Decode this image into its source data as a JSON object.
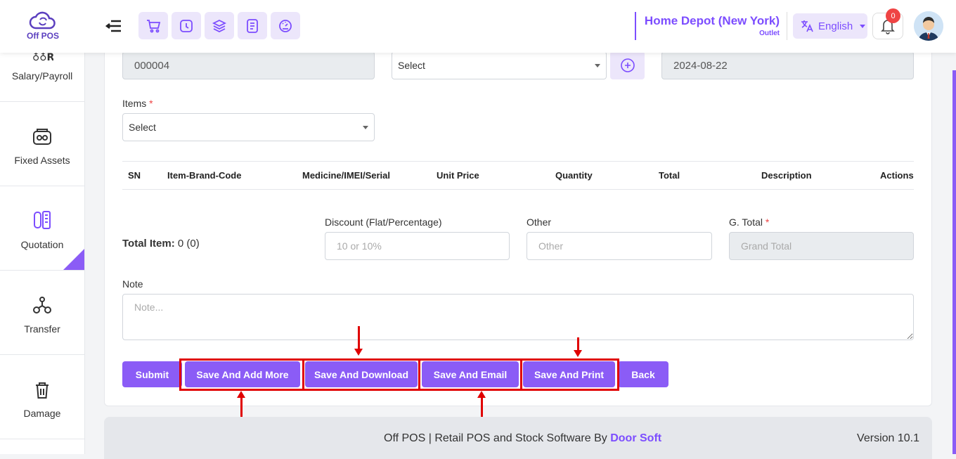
{
  "app": {
    "logo_text": "Off POS"
  },
  "header": {
    "outlet_name": "Home Depot (New York)",
    "outlet_type": "Outlet",
    "language": "English",
    "notification_count": "0"
  },
  "sidebar": {
    "items": [
      {
        "label": "Salary/Payroll",
        "icon": "payroll-icon"
      },
      {
        "label": "Fixed Assets",
        "icon": "fixed-assets-icon"
      },
      {
        "label": "Quotation",
        "icon": "quotation-icon",
        "active": true
      },
      {
        "label": "Transfer",
        "icon": "transfer-icon"
      },
      {
        "label": "Damage",
        "icon": "trash-icon"
      }
    ]
  },
  "form": {
    "reference_no": "000004",
    "customer_select": "Select",
    "date": "2024-08-22",
    "items_label": "Items",
    "items_select": "Select",
    "table_headers": [
      "SN",
      "Item-Brand-Code",
      "Medicine/IMEI/Serial",
      "Unit Price",
      "Quantity",
      "Total",
      "Description",
      "Actions"
    ],
    "total_item_label": "Total Item:",
    "total_item_value": "0 (0)",
    "discount_label": "Discount (Flat/Percentage)",
    "discount_placeholder": "10 or 10%",
    "other_label": "Other",
    "other_placeholder": "Other",
    "gtotal_label": "G. Total",
    "gtotal_placeholder": "Grand Total",
    "note_label": "Note",
    "note_placeholder": "Note...",
    "required_mark": "*"
  },
  "buttons": {
    "submit": "Submit",
    "save_add_more": "Save And Add More",
    "save_download": "Save And Download",
    "save_email": "Save And Email",
    "save_print": "Save And Print",
    "back": "Back"
  },
  "footer": {
    "text": "Off POS | Retail POS and Stock Software By ",
    "brand": "Door Soft",
    "version": "Version 10.1"
  },
  "colors": {
    "accent": "#8b5cf6",
    "accent_dark": "#7c4dff",
    "highlight": "#e00000"
  }
}
